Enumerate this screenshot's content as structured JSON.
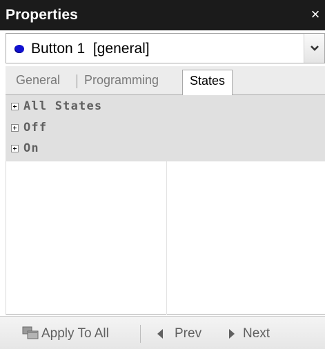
{
  "window": {
    "title": "Properties",
    "close_glyph": "×"
  },
  "selector": {
    "value": "Button 1  [general]",
    "dot_color": "#1010d0",
    "icon": "chevron-down-icon"
  },
  "tabs": [
    {
      "label": "General",
      "active": false
    },
    {
      "label": "Programming",
      "active": false
    },
    {
      "label": "States",
      "active": true
    }
  ],
  "states": [
    {
      "label": "All States",
      "expanded": false
    },
    {
      "label": "Off",
      "expanded": false
    },
    {
      "label": "On",
      "expanded": false
    }
  ],
  "toolbar": {
    "apply_label": "Apply To All",
    "prev_label": "Prev",
    "next_label": "Next"
  },
  "colors": {
    "title_bar": "#1b1b1b",
    "state_list_bg": "#e0e0e0",
    "tab_bar_bg": "#ececec"
  }
}
